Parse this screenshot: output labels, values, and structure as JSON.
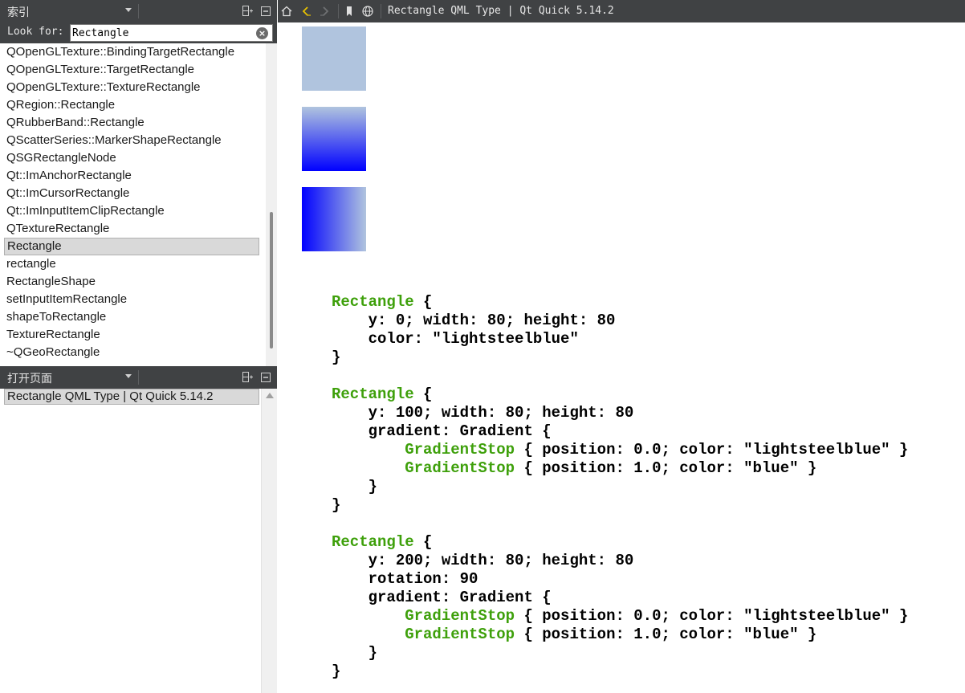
{
  "index_pane": {
    "header_title": "索引",
    "search": {
      "label": "Look for:",
      "value": "Rectangle"
    },
    "items": [
      {
        "label": "QOpenGLTexture::BindingTargetRectangle"
      },
      {
        "label": "QOpenGLTexture::TargetRectangle"
      },
      {
        "label": "QOpenGLTexture::TextureRectangle"
      },
      {
        "label": "QRegion::Rectangle"
      },
      {
        "label": "QRubberBand::Rectangle"
      },
      {
        "label": "QScatterSeries::MarkerShapeRectangle"
      },
      {
        "label": "QSGRectangleNode"
      },
      {
        "label": "Qt::ImAnchorRectangle"
      },
      {
        "label": "Qt::ImCursorRectangle"
      },
      {
        "label": "Qt::ImInputItemClipRectangle"
      },
      {
        "label": "QTextureRectangle"
      },
      {
        "label": "Rectangle",
        "selected": true
      },
      {
        "label": "rectangle"
      },
      {
        "label": "RectangleShape"
      },
      {
        "label": "setInputItemRectangle"
      },
      {
        "label": "shapeToRectangle"
      },
      {
        "label": "TextureRectangle"
      },
      {
        "label": "~QGeoRectangle"
      }
    ]
  },
  "open_pages_pane": {
    "header_title": "打开页面",
    "items": [
      {
        "label": "Rectangle QML Type | Qt Quick 5.14.2"
      }
    ]
  },
  "doc_toolbar": {
    "title": "Rectangle QML Type | Qt Quick 5.14.2",
    "icons": [
      "home-icon",
      "back-icon",
      "forward-icon",
      "bookmark-icon",
      "globe-icon"
    ]
  },
  "demo_colors": {
    "lightsteelblue": "#b0c4de",
    "blue": "#0000ff"
  },
  "code_sample": {
    "keyword_color": "#3ea00b",
    "lines": [
      [
        {
          "t": "Rectangle",
          "kw": true
        },
        {
          "t": " {"
        }
      ],
      [
        {
          "t": "    y: 0; width: 80; height: 80"
        }
      ],
      [
        {
          "t": "    color: \"lightsteelblue\""
        }
      ],
      [
        {
          "t": "}"
        }
      ],
      [],
      [
        {
          "t": "Rectangle",
          "kw": true
        },
        {
          "t": " {"
        }
      ],
      [
        {
          "t": "    y: 100; width: 80; height: 80"
        }
      ],
      [
        {
          "t": "    gradient: Gradient {"
        }
      ],
      [
        {
          "t": "        "
        },
        {
          "t": "GradientStop",
          "kw": true
        },
        {
          "t": " { position: 0.0; color: \"lightsteelblue\" }"
        }
      ],
      [
        {
          "t": "        "
        },
        {
          "t": "GradientStop",
          "kw": true
        },
        {
          "t": " { position: 1.0; color: \"blue\" }"
        }
      ],
      [
        {
          "t": "    }"
        }
      ],
      [
        {
          "t": "}"
        }
      ],
      [],
      [
        {
          "t": "Rectangle",
          "kw": true
        },
        {
          "t": " {"
        }
      ],
      [
        {
          "t": "    y: 200; width: 80; height: 80"
        }
      ],
      [
        {
          "t": "    rotation: 90"
        }
      ],
      [
        {
          "t": "    gradient: Gradient {"
        }
      ],
      [
        {
          "t": "        "
        },
        {
          "t": "GradientStop",
          "kw": true
        },
        {
          "t": " { position: 0.0; color: \"lightsteelblue\" }"
        }
      ],
      [
        {
          "t": "        "
        },
        {
          "t": "GradientStop",
          "kw": true
        },
        {
          "t": " { position: 1.0; color: \"blue\" }"
        }
      ],
      [
        {
          "t": "    }"
        }
      ],
      [
        {
          "t": "}"
        }
      ]
    ]
  }
}
